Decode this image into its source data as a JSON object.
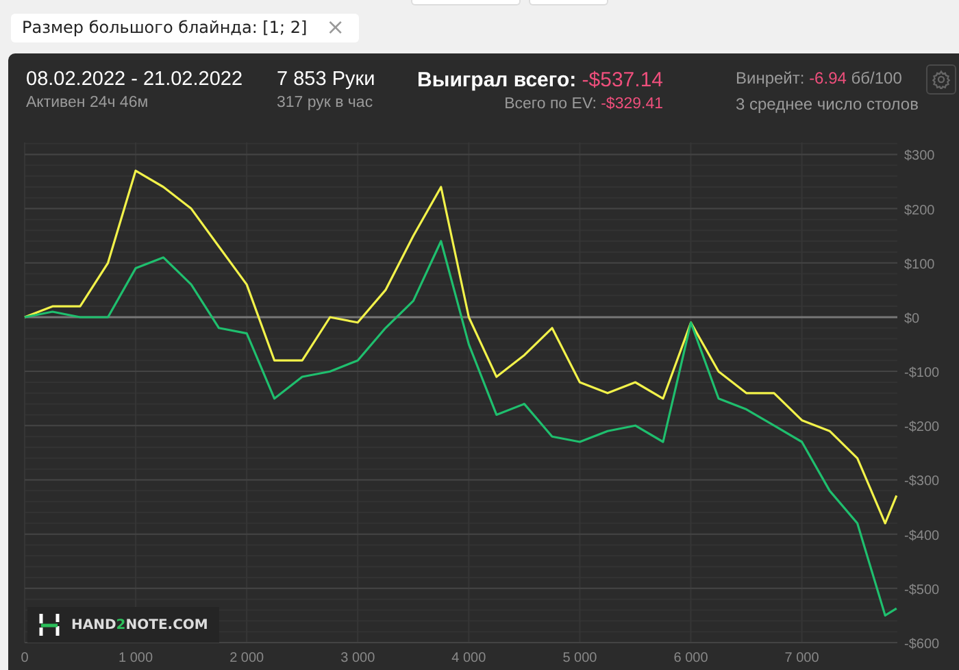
{
  "filter_chip": {
    "label": "Размер большого блайнда: [1; 2]",
    "close": "×"
  },
  "summary": {
    "date_range": "08.02.2022 - 21.02.2022",
    "active": "Активен 24ч 46м",
    "hands": "7 853 Руки",
    "hands_per_hour": "317 рук в час",
    "won_label": "Выиграл всего:",
    "won_value": "-$537.14",
    "ev_label": "Всего по EV:",
    "ev_value": "-$329.41",
    "winrate_label": "Винрейт:",
    "winrate_value": "-6.94",
    "winrate_unit": "бб/100",
    "avg_tables": "3 среднее число столов"
  },
  "chart": {
    "logo_parts": [
      "HAND",
      "2",
      "NOTE.COM"
    ],
    "chart_data": {
      "type": "line",
      "grid": true,
      "x": [
        0,
        250,
        500,
        750,
        1000,
        1250,
        1500,
        1750,
        2000,
        2250,
        2500,
        2750,
        3000,
        3250,
        3500,
        3750,
        4000,
        4250,
        4500,
        4750,
        5000,
        5250,
        5500,
        5750,
        6000,
        6250,
        6500,
        6750,
        7000,
        7250,
        7500,
        7750,
        7853
      ],
      "series": [
        {
          "color": "#f2f24a",
          "values": [
            0,
            20,
            20,
            100,
            270,
            240,
            200,
            130,
            60,
            -80,
            -80,
            0,
            -10,
            50,
            150,
            240,
            0,
            -110,
            -70,
            -20,
            -120,
            -140,
            -120,
            -150,
            -10,
            -100,
            -140,
            -140,
            -190,
            -210,
            -260,
            -380,
            -329
          ]
        },
        {
          "color": "#1fbf6e",
          "values": [
            0,
            10,
            0,
            0,
            90,
            110,
            60,
            -20,
            -30,
            -150,
            -110,
            -100,
            -80,
            -20,
            30,
            140,
            -50,
            -180,
            -160,
            -220,
            -230,
            -210,
            -200,
            -230,
            -10,
            -150,
            -170,
            -200,
            -230,
            -320,
            -380,
            -550,
            -537
          ]
        }
      ],
      "xlim": [
        0,
        7860
      ],
      "ylim": [
        -600,
        322
      ],
      "xticks": [
        {
          "value": 0,
          "label": "0"
        },
        {
          "value": 1000,
          "label": "1 000"
        },
        {
          "value": 2000,
          "label": "2 000"
        },
        {
          "value": 3000,
          "label": "3 000"
        },
        {
          "value": 4000,
          "label": "4 000"
        },
        {
          "value": 5000,
          "label": "5 000"
        },
        {
          "value": 6000,
          "label": "6 000"
        },
        {
          "value": 7000,
          "label": "7 000"
        }
      ],
      "yticks": [
        {
          "value": 300,
          "label": "$300"
        },
        {
          "value": 200,
          "label": "$200"
        },
        {
          "value": 100,
          "label": "$100"
        },
        {
          "value": 0,
          "label": "$0"
        },
        {
          "value": -100,
          "label": "-$100"
        },
        {
          "value": -200,
          "label": "-$200"
        },
        {
          "value": -300,
          "label": "-$300"
        },
        {
          "value": -400,
          "label": "-$400"
        },
        {
          "value": -500,
          "label": "-$500"
        },
        {
          "value": -600,
          "label": "-$600"
        }
      ]
    }
  }
}
